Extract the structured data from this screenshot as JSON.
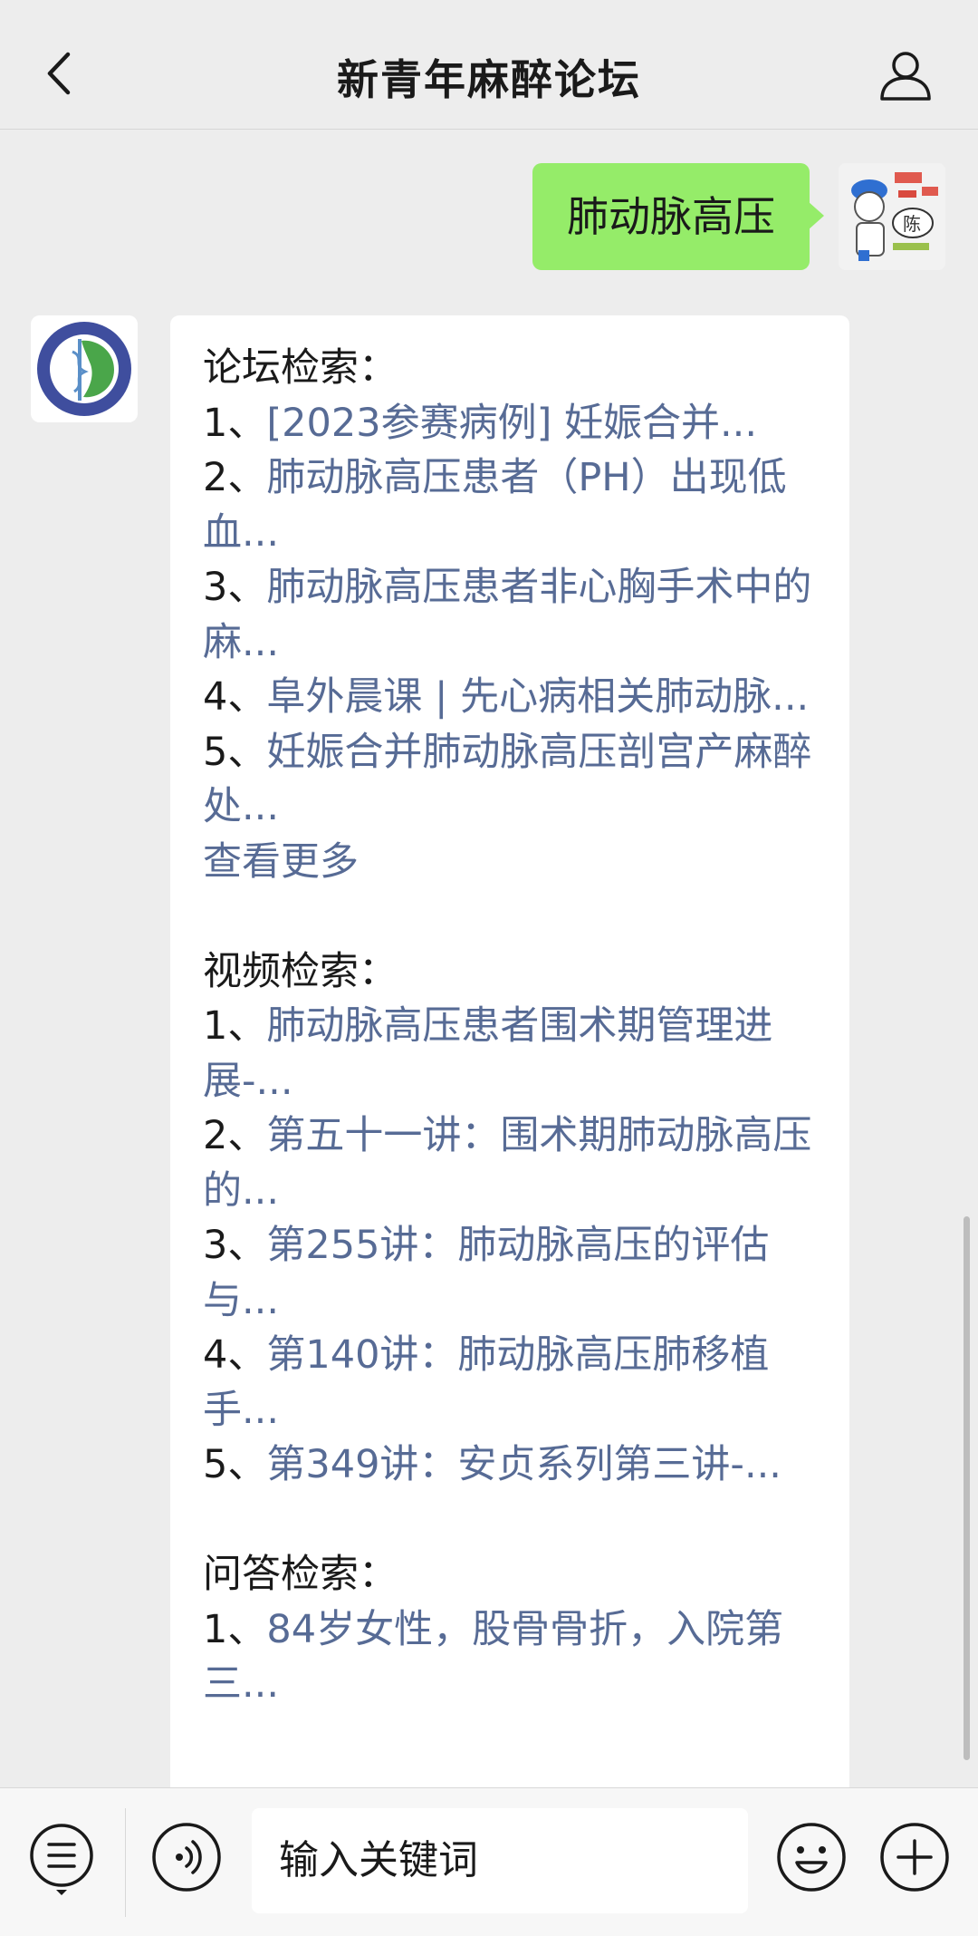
{
  "header": {
    "title": "新青年麻醉论坛",
    "back_icon": "chevron-left-icon",
    "profile_icon": "person-icon"
  },
  "sent_message": {
    "text": "肺动脉高压"
  },
  "reply": {
    "forum_heading": "论坛检索：",
    "forum_items": [
      {
        "num": "1、",
        "text": "[2023参赛病例] 妊娠合并..."
      },
      {
        "num": "2、",
        "text": "肺动脉高压患者（PH）出现低血..."
      },
      {
        "num": "3、",
        "text": "肺动脉高压患者非心胸手术中的麻..."
      },
      {
        "num": "4、",
        "text": "阜外晨课 | 先心病相关肺动脉..."
      },
      {
        "num": "5、",
        "text": "妊娠合并肺动脉高压剖宫产麻醉处..."
      }
    ],
    "more_label": "查看更多",
    "video_heading": "视频检索：",
    "video_items": [
      {
        "num": "1、",
        "text": "肺动脉高压患者围术期管理进展-..."
      },
      {
        "num": "2、",
        "text": "第五十一讲：围术期肺动脉高压的..."
      },
      {
        "num": "3、",
        "text": "第255讲：肺动脉高压的评估与..."
      },
      {
        "num": "4、",
        "text": "第140讲：肺动脉高压肺移植手..."
      },
      {
        "num": "5、",
        "text": "第349讲：安贞系列第三讲-..."
      }
    ],
    "qa_heading": "问答检索：",
    "qa_items": [
      {
        "num": "1、",
        "text": "84岁女性，股骨骨折，入院第三..."
      }
    ]
  },
  "footer": {
    "input_placeholder": "输入关键词",
    "menu_icon": "menu-list-icon",
    "voice_icon": "voice-icon",
    "emoji_icon": "emoji-icon",
    "plus_icon": "plus-icon"
  },
  "colors": {
    "sent_bubble": "#95ec69",
    "link": "#576b95",
    "background": "#ededed"
  }
}
